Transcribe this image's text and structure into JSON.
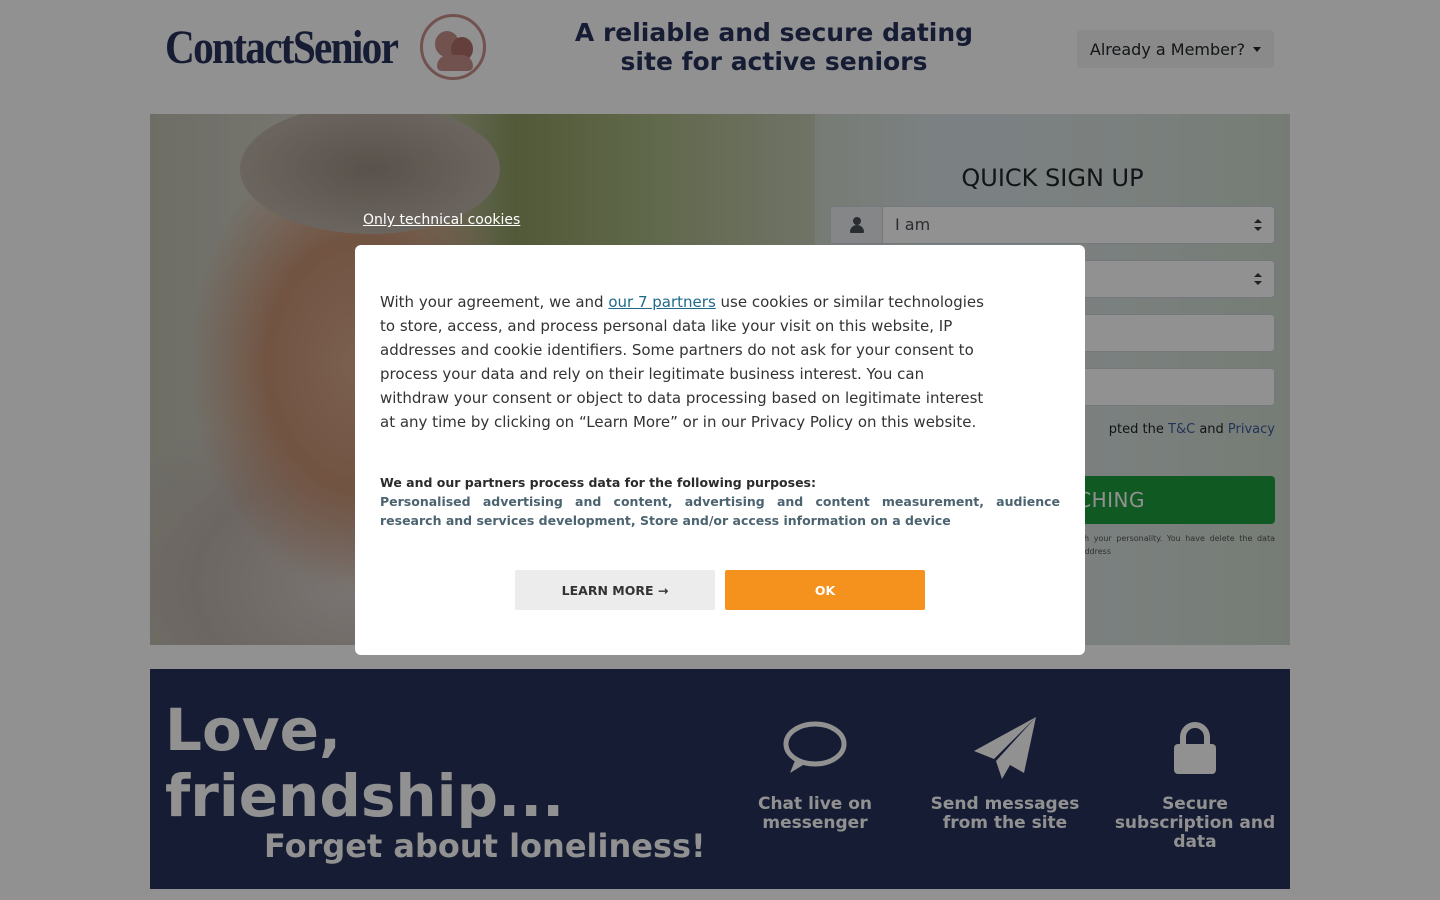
{
  "header": {
    "logo_text": "ContactSenior",
    "tagline": "A reliable and secure dating site for active seniors",
    "member_button": "Already a Member?"
  },
  "signup": {
    "title": "QUICK SIGN UP",
    "gender_select": "I am",
    "terms_prefix": "pted the",
    "terms_tc": "T&C",
    "terms_and": "and",
    "terms_privacy": "Privacy",
    "start_button": "CHING",
    "fine_print": "company GDM, the data controller, and its ofiles that match your personality. You have delete the data concerning you, or to object purposes by contacting us at the address"
  },
  "features": {
    "title_line1": "Love,",
    "title_line2": "friendship...",
    "subtitle": "Forget about loneliness!",
    "items": [
      {
        "icon": "chat-bubble-icon",
        "label": "Chat live on messenger"
      },
      {
        "icon": "paper-plane-icon",
        "label": "Send messages from the site"
      },
      {
        "icon": "lock-icon",
        "label": "Secure subscription and data"
      }
    ]
  },
  "consent": {
    "technical_link": "Only technical cookies",
    "text_before_link": "With your agreement, we and ",
    "partners_link": "our 7 partners",
    "text_after_link": " use cookies or similar technologies to store, access, and process personal data like your visit on this website, IP addresses and cookie identifiers. Some partners do not ask for your consent to process your data and rely on their legitimate business interest. You can withdraw your consent or object to data processing based on legitimate interest at any time by clicking on “Learn More” or in our Privacy Policy on this website.",
    "purposes_heading": "We and our partners process data for the following purposes:",
    "purposes_list": "Personalised advertising and content, advertising and content measurement, audience research and services development, Store and/or access information on a device",
    "learn_more_button": "LEARN MORE →",
    "ok_button": "OK"
  },
  "colors": {
    "brand_navy": "#27325a",
    "accent_orange": "#f5921e",
    "start_green": "#1f9d3f",
    "link_teal": "#1d6a8a"
  }
}
